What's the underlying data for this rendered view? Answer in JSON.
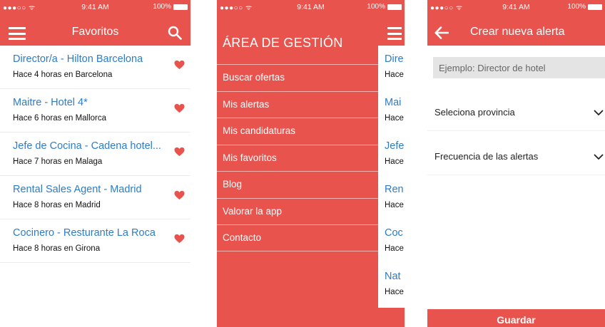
{
  "colors": {
    "accent": "#e9534d",
    "link": "#2e7cc8",
    "field_bg": "#e4e4e4"
  },
  "status_bar": {
    "carrier": "●●●○○ ᯤ",
    "time": "9:41 AM",
    "battery": "100%"
  },
  "favorites": {
    "title": "Favoritos",
    "icons": [
      "menu-icon",
      "search-icon",
      "heart-icon"
    ],
    "items": [
      {
        "title": "Director/a - Hilton Barcelona",
        "subtitle": "Hace 4 horas en Barcelona"
      },
      {
        "title": "Maitre - Hotel 4*",
        "subtitle": "Hace 6  horas en Mallorca"
      },
      {
        "title": "Jefe de Cocina - Cadena hotel...",
        "subtitle": "Hace 7 horas en Malaga"
      },
      {
        "title": "Rental Sales Agent - Madrid",
        "subtitle": "Hace 8 horas en Madrid"
      },
      {
        "title": "Cocinero - Resturante La Roca",
        "subtitle": "Hace 8 horas en Girona"
      }
    ]
  },
  "drawer": {
    "title": "ÁREA DE GESTIÓN",
    "items": [
      "Buscar ofertas",
      "Mis alertas",
      "Mis candidaturas",
      "Mis favoritos",
      "Blog",
      "Valorar la app",
      "Contacto"
    ],
    "peek_items": [
      {
        "title": "Dire",
        "subtitle": "Hace"
      },
      {
        "title": "Mai",
        "subtitle": "Hace"
      },
      {
        "title": "Jefe",
        "subtitle": "Hace"
      },
      {
        "title": "Ren",
        "subtitle": "Hace"
      },
      {
        "title": "Coc",
        "subtitle": "Hace"
      },
      {
        "title": "Nat",
        "subtitle": "Hace"
      }
    ]
  },
  "new_alert": {
    "title": "Crear nueva alerta",
    "search_placeholder": "Ejemplo: Director de hotel",
    "province_label": "Seleciona provincia",
    "frequency_label": "Frecuencia de las alertas",
    "save_label": "Guardar",
    "icons": [
      "back-arrow-icon",
      "chevron-down-icon"
    ]
  }
}
